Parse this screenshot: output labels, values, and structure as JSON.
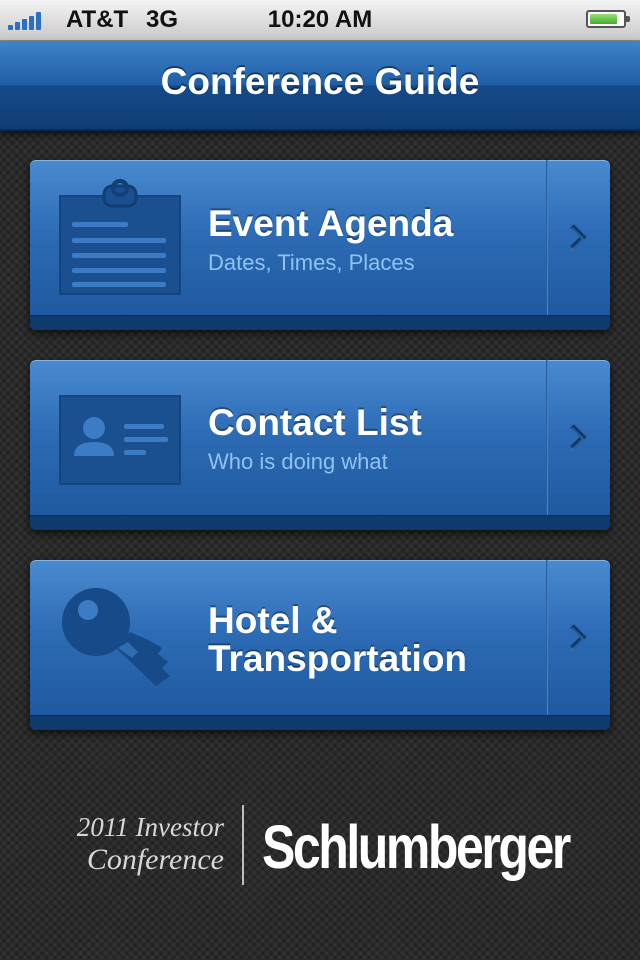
{
  "status_bar": {
    "carrier": "AT&T",
    "network": "3G",
    "time": "10:20 AM",
    "signal_icon": "signal-bars-icon",
    "battery_icon": "battery-icon",
    "battery_level": 0.85
  },
  "nav": {
    "title": "Conference Guide"
  },
  "menu": [
    {
      "title": "Event Agenda",
      "subtitle": "Dates, Times, Places",
      "icon": "clipboard-icon"
    },
    {
      "title": "Contact List",
      "subtitle": "Who is doing what",
      "icon": "contact-card-icon"
    },
    {
      "title_line1": "Hotel &",
      "title_line2": "Transportation",
      "icon": "key-icon"
    }
  ],
  "footer": {
    "line1": "2011 Investor",
    "line2": "Conference",
    "brand": "Schlumberger"
  },
  "colors": {
    "nav_blue": "#1f5ea6",
    "card_blue": "#2c6bb4",
    "subtitle_blue": "#8fc3f5",
    "background": "#2a2a2a"
  }
}
